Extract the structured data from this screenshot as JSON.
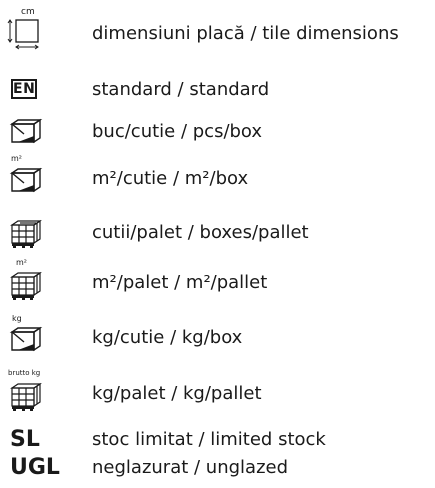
{
  "rows": [
    {
      "icon": "tile-dimensions-icon",
      "icon_text": "cm",
      "label": "dimensiuni placă / tile dimensions"
    },
    {
      "icon": "standard-icon",
      "icon_text": "EN",
      "label": "standard / standard"
    },
    {
      "icon": "box-icon",
      "label": "buc/cutie / pcs/box"
    },
    {
      "icon": "box-m2-icon",
      "icon_text": "m²",
      "label": "m²/cutie / m²/box"
    },
    {
      "icon": "pallet-icon",
      "label": "cutii/palet / boxes/pallet"
    },
    {
      "icon": "pallet-m2-icon",
      "icon_text": "m²",
      "label": "m²/palet / m²/pallet"
    },
    {
      "icon": "box-kg-icon",
      "icon_text": "kg",
      "label": "kg/cutie / kg/box"
    },
    {
      "icon": "pallet-kg-icon",
      "icon_text": "brutto kg",
      "label": "kg/palet / kg/pallet"
    },
    {
      "icon": "limited-stock-code",
      "icon_text": "SL",
      "label": "stoc limitat / limited stock"
    },
    {
      "icon": "unglazed-code",
      "icon_text": "UGL",
      "label": "neglazurat / unglazed"
    }
  ]
}
